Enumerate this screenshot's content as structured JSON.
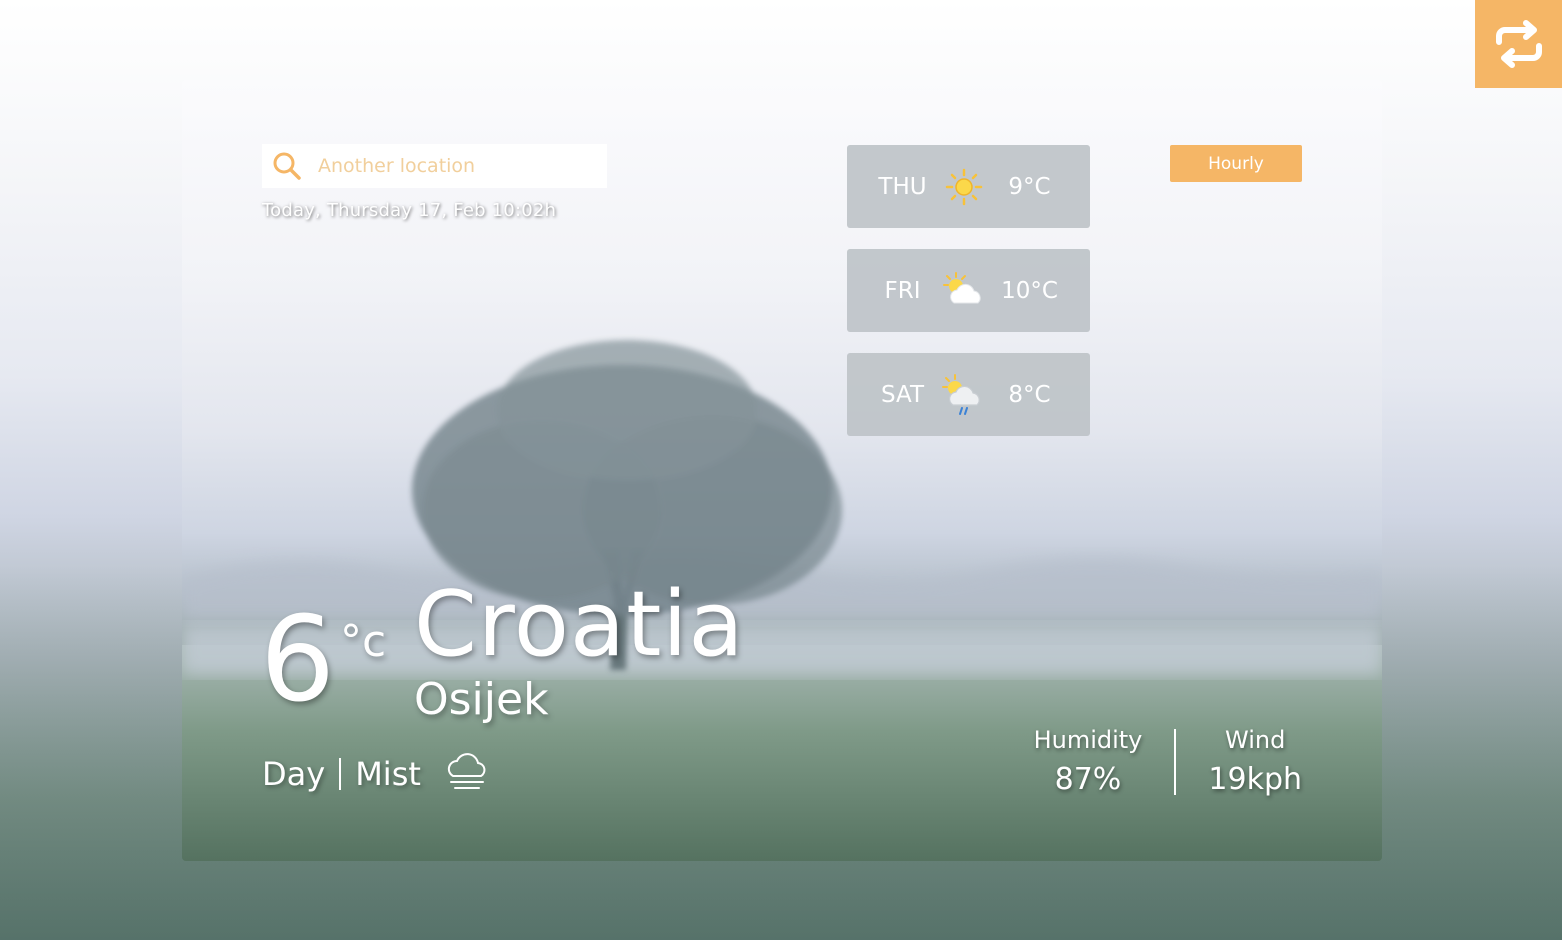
{
  "search": {
    "placeholder": "Another location"
  },
  "current": {
    "date_text": "Today, Thursday 17, Feb 10:02h",
    "temperature": "6",
    "unit": "°c",
    "country": "Croatia",
    "city": "Osijek",
    "period": "Day",
    "condition": "Mist",
    "condition_icon": "mist-cloud-icon"
  },
  "forecast": [
    {
      "day": "THU",
      "temp": "9°C",
      "icon": "sun-icon"
    },
    {
      "day": "FRI",
      "temp": "10°C",
      "icon": "partly-cloudy-icon"
    },
    {
      "day": "SAT",
      "temp": "8°C",
      "icon": "rain-shower-icon"
    }
  ],
  "toggle": {
    "hourly_label": "Hourly"
  },
  "stats": {
    "humidity_label": "Humidity",
    "humidity_value": "87%",
    "wind_label": "Wind",
    "wind_value": "19kph"
  },
  "colors": {
    "accent": "#f5b666",
    "forecast_card": "#bec3c8"
  },
  "icons": {
    "swap": "swap-arrows-icon",
    "search": "search-icon"
  }
}
